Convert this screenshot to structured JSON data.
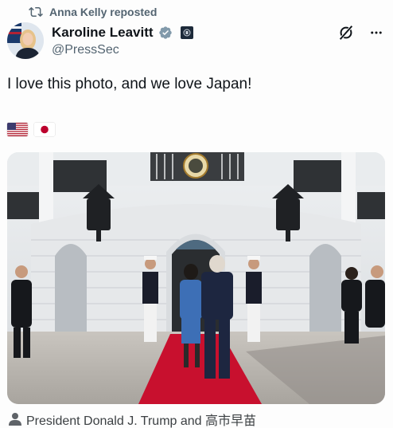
{
  "repost": {
    "text": "Anna Kelly reposted",
    "icon": "repost-icon"
  },
  "author": {
    "display_name": "Karoline Leavitt",
    "handle": "@PressSec",
    "verified_color": "#829aab",
    "avatar_icon": "profile-avatar"
  },
  "post": {
    "text": "I love this photo, and we love Japan!",
    "flags": [
      "us-flag-icon",
      "japan-flag-icon"
    ]
  },
  "photo": {
    "caption": "President Donald J. Trump and 高市早苗",
    "caption_icon": "person-tag-icon"
  },
  "colors": {
    "accent_text": "#536471",
    "carpet": "#c8102e"
  }
}
